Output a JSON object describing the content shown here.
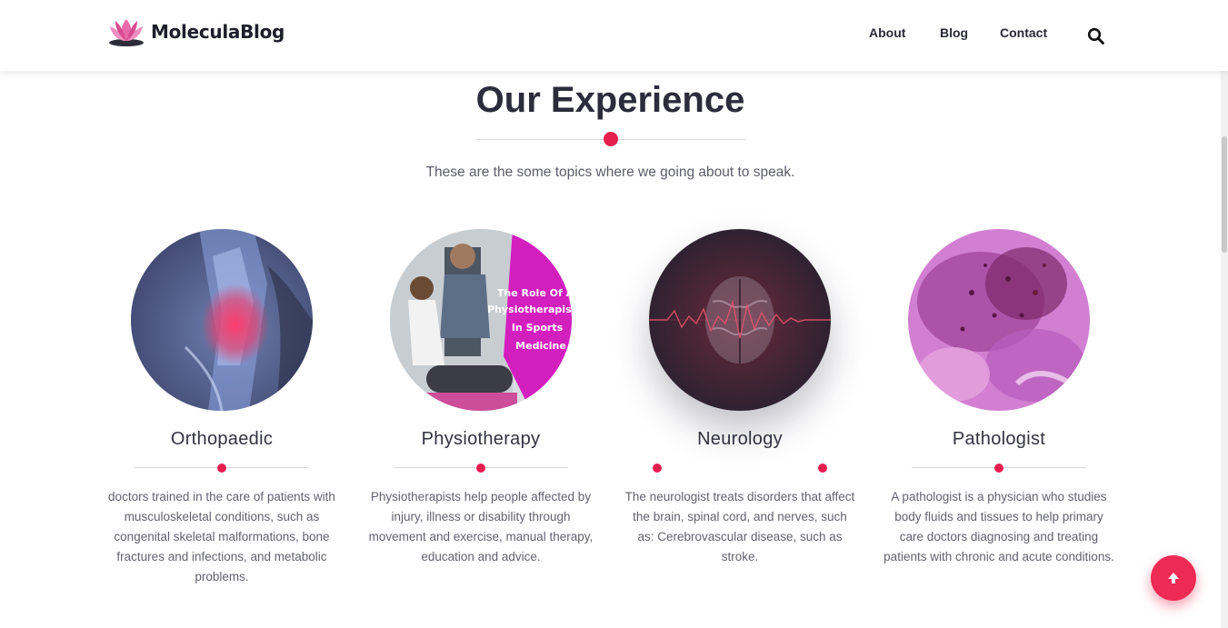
{
  "brand": {
    "name": "MoleculaBlog",
    "logo_icon": "lotus-icon",
    "accent": "#e51e4f"
  },
  "nav": {
    "items": [
      "About",
      "Blog",
      "Contact"
    ],
    "search_icon": "search-icon"
  },
  "section": {
    "title": "Our Experience",
    "subtitle": "These are the some topics where we going about to speak."
  },
  "cards": [
    {
      "title": "Orthopaedic",
      "description": "doctors trained in the care of patients with musculoskeletal conditions, such as congenital skeletal malformations, bone fractures and infections, and metabolic problems.",
      "image": "knee-xray-illustration"
    },
    {
      "title": "Physiotherapy",
      "description": "Physiotherapists help people affected by injury, illness or disability through movement and exercise, manual therapy, education and advice.",
      "image": "physiotherapy-photo",
      "image_caption": [
        "The Role Of A",
        "Physiotherapist",
        "In Sports",
        "Medicine"
      ]
    },
    {
      "title": "Neurology",
      "description": "The neurologist treats disorders that affect the brain, spinal cord, and nerves, such as: Cerebrovascular disease, such as stroke.",
      "image": "brain-scan-illustration"
    },
    {
      "title": "Pathologist",
      "description": "A pathologist is a physician who studies body fluids and tissues to help primary care doctors diagnosing and treating patients with chronic and acute conditions.",
      "image": "tissue-micrograph"
    }
  ],
  "scroll_top": {
    "icon": "arrow-up-icon",
    "color": "#ee2a55"
  }
}
